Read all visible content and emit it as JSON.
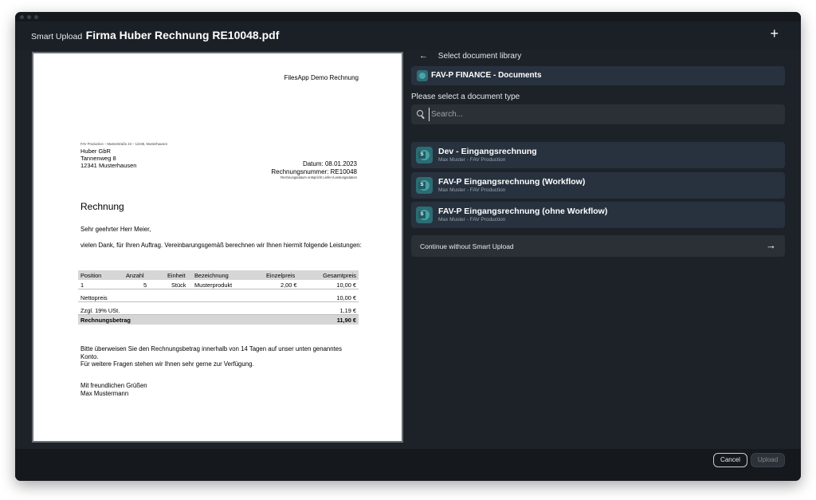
{
  "header": {
    "prefix": "Smart Upload",
    "title": "Firma Huber Rechnung RE10048.pdf",
    "add_label": "+"
  },
  "document": {
    "page_title": "FilesApp Demo Rechnung",
    "sender_line": "FAV Production – Musterstraße 23 – 12345, Musterhausen",
    "recipient": [
      "Huber GbR",
      "Tannenweg 8",
      "12341 Musterhausen"
    ],
    "date": "Datum: 08.01.2023",
    "invoice_number": "Rechnungsnummer: RE10048",
    "date_note": "Rechnungsdatum entspricht Liefer-/Leistungsdatum",
    "heading": "Rechnung",
    "greeting": "Sehr geehrter Herr Meier,",
    "intro": "vielen Dank, für Ihren Auftrag. Vereinbarungsgemäß berechnen wir Ihnen hiermit folgende Leistungen:",
    "table": {
      "headers": [
        "Position",
        "Anzahl",
        "Einheit",
        "Bezeichnung",
        "Einzelpreis",
        "Gesamtpreis"
      ],
      "rows": [
        [
          "1",
          "5",
          "Stück",
          "Musterprodukt",
          "2,00 €",
          "10,00 €"
        ]
      ],
      "net_label": "Nettopreis",
      "net_value": "10,00 €",
      "tax_label": "Zzgl. 19% USt.",
      "tax_value": "1,19 €",
      "total_label": "Rechnungsbetrag",
      "total_value": "11,90 €"
    },
    "payment_note": "Bitte überweisen Sie den Rechnungsbetrag innerhalb von 14 Tagen auf unser unten genanntes Konto.",
    "questions_note": "Für weitere Fragen stehen wir Ihnen sehr gerne zur Verfügung.",
    "closing": "Mit freundlichen Grüßen",
    "signature": "Max Mustermann"
  },
  "panel": {
    "back_label": "Select document library",
    "library_name": "FAV-P FINANCE - Documents",
    "select_type_label": "Please select a document type",
    "search_placeholder": "Search...",
    "types": [
      {
        "name": "Dev - Eingangsrechnung",
        "sub": "Max Muster - FAV Production"
      },
      {
        "name": "FAV-P Eingangsrechnung (Workflow)",
        "sub": "Max Muster - FAV Production"
      },
      {
        "name": "FAV-P Eingangsrechnung (ohne Workflow)",
        "sub": "Max Muster - FAV Production"
      }
    ],
    "continue_label": "Continue without Smart Upload"
  },
  "footer": {
    "cancel_label": "Cancel",
    "upload_label": "Upload"
  },
  "icons": {
    "back": "arrow-left-icon",
    "search": "search-icon",
    "library": "sharepoint-icon",
    "continue": "arrow-right-icon",
    "add": "plus-icon"
  }
}
